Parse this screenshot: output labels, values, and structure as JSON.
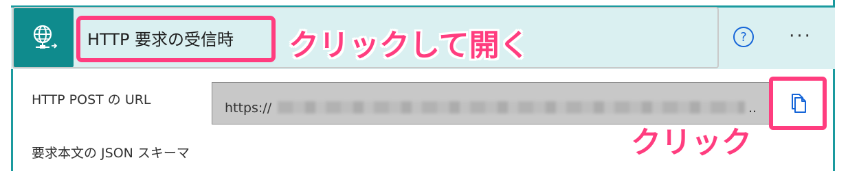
{
  "header": {
    "icon": "http-request-globe-icon",
    "title": "HTTP 要求の受信時",
    "help_label": "?",
    "more_label": "···"
  },
  "fields": {
    "url_label": "HTTP POST の URL",
    "url_value": "https://",
    "url_ellipsis": "..",
    "schema_label": "要求本文の JSON スキーマ"
  },
  "annotations": {
    "open": "クリックして開く",
    "click": "クリック"
  },
  "colors": {
    "accent": "#0f8b8d",
    "header_bg": "#daf0f1",
    "highlight": "#ff3d7f",
    "link": "#1565d8"
  }
}
